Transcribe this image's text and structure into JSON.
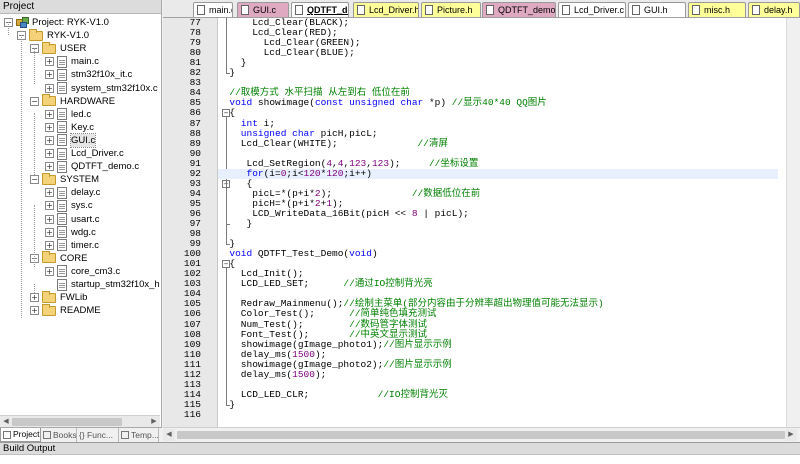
{
  "project_pane": {
    "title": "Project",
    "tree": [
      {
        "label": "Project: RYK-V1.0",
        "kind": "project",
        "level": 0,
        "expander": "-"
      },
      {
        "label": "RYK-V1.0",
        "kind": "folder",
        "level": 1,
        "expander": "-"
      },
      {
        "label": "USER",
        "kind": "folder",
        "level": 2,
        "expander": "-"
      },
      {
        "label": "main.c",
        "kind": "file",
        "level": 3,
        "expander": "+"
      },
      {
        "label": "stm32f10x_it.c",
        "kind": "file",
        "level": 3,
        "expander": "+"
      },
      {
        "label": "system_stm32f10x.c",
        "kind": "file",
        "level": 3,
        "expander": "+"
      },
      {
        "label": "HARDWARE",
        "kind": "folder",
        "level": 2,
        "expander": "-"
      },
      {
        "label": "led.c",
        "kind": "file",
        "level": 3,
        "expander": "+"
      },
      {
        "label": "Key.c",
        "kind": "file",
        "level": 3,
        "expander": "+"
      },
      {
        "label": "GUI.c",
        "kind": "file",
        "level": 3,
        "expander": "+",
        "selected": true
      },
      {
        "label": "Lcd_Driver.c",
        "kind": "file",
        "level": 3,
        "expander": "+"
      },
      {
        "label": "QDTFT_demo.c",
        "kind": "file",
        "level": 3,
        "expander": "+"
      },
      {
        "label": "SYSTEM",
        "kind": "folder",
        "level": 2,
        "expander": "-"
      },
      {
        "label": "delay.c",
        "kind": "file",
        "level": 3,
        "expander": "+"
      },
      {
        "label": "sys.c",
        "kind": "file",
        "level": 3,
        "expander": "+"
      },
      {
        "label": "usart.c",
        "kind": "file",
        "level": 3,
        "expander": "+"
      },
      {
        "label": "wdg.c",
        "kind": "file",
        "level": 3,
        "expander": "+"
      },
      {
        "label": "timer.c",
        "kind": "file",
        "level": 3,
        "expander": "+"
      },
      {
        "label": "CORE",
        "kind": "folder",
        "level": 2,
        "expander": "-"
      },
      {
        "label": "core_cm3.c",
        "kind": "file",
        "level": 3,
        "expander": "+"
      },
      {
        "label": "startup_stm32f10x_hd.s",
        "kind": "file",
        "level": 3,
        "expander": ""
      },
      {
        "label": "FWLib",
        "kind": "folder",
        "level": 2,
        "expander": "+"
      },
      {
        "label": "README",
        "kind": "folder",
        "level": 2,
        "expander": "+"
      }
    ],
    "tabs": [
      {
        "label": "Project",
        "active": true
      },
      {
        "label": "Books",
        "active": false
      },
      {
        "label": "{} Func...",
        "active": false
      },
      {
        "label": "Temp...",
        "active": false
      }
    ]
  },
  "editor_tabs": [
    {
      "label": "main.c",
      "color": "#ffffff",
      "active": false
    },
    {
      "label": "GUI.c",
      "color": "#e0a9c2",
      "active": false
    },
    {
      "label": "QDTFT_demo.c",
      "color": "#ffffff",
      "active": true
    },
    {
      "label": "Lcd_Driver.h",
      "color": "#ffff99",
      "active": false
    },
    {
      "label": "Picture.h",
      "color": "#ffff99",
      "active": false
    },
    {
      "label": "QDTFT_demo.h",
      "color": "#e0a9c2",
      "active": false
    },
    {
      "label": "Lcd_Driver.c",
      "color": "#ffffff",
      "active": false
    },
    {
      "label": "GUI.h",
      "color": "#ffffff",
      "active": false
    },
    {
      "label": "misc.h",
      "color": "#ffff99",
      "active": false
    },
    {
      "label": "delay.h",
      "color": "#ffff99",
      "active": false
    }
  ],
  "editor": {
    "lines": [
      {
        "n": "77",
        "tokens": [
          [
            "",
            "      Lcd_Clear(BLACK);"
          ]
        ]
      },
      {
        "n": "78",
        "tokens": [
          [
            "",
            "      Lcd_Clear(RED);"
          ]
        ]
      },
      {
        "n": "79",
        "tokens": [
          [
            "",
            "        Lcd_Clear(GREEN);"
          ]
        ]
      },
      {
        "n": "80",
        "tokens": [
          [
            "",
            "        Lcd_Clear(BLUE);"
          ]
        ]
      },
      {
        "n": "81",
        "tokens": [
          [
            "",
            "    }"
          ]
        ]
      },
      {
        "n": "82",
        "tokens": [
          [
            "",
            "  }"
          ]
        ]
      },
      {
        "n": "83",
        "tokens": [
          [
            "",
            ""
          ]
        ]
      },
      {
        "n": "84",
        "tokens": [
          [
            "cm",
            "  //取模方式 水平扫描 从左到右 低位在前"
          ]
        ]
      },
      {
        "n": "85",
        "tokens": [
          [
            "kw",
            "  void"
          ],
          [
            "",
            " showimage("
          ],
          [
            "kw",
            "const unsigned char"
          ],
          [
            "",
            " *p) "
          ],
          [
            "cm",
            "//显示40*40 QQ图片"
          ]
        ]
      },
      {
        "n": "86",
        "tokens": [
          [
            "",
            "  {"
          ]
        ]
      },
      {
        "n": "87",
        "tokens": [
          [
            "kw",
            "    int"
          ],
          [
            "",
            " i;"
          ]
        ]
      },
      {
        "n": "88",
        "tokens": [
          [
            "kw",
            "    unsigned char"
          ],
          [
            "",
            " picH,picL;"
          ]
        ]
      },
      {
        "n": "89",
        "tokens": [
          [
            "",
            "    Lcd_Clear(WHITE);              "
          ],
          [
            "cm",
            "//清屏"
          ]
        ]
      },
      {
        "n": "90",
        "tokens": [
          [
            "",
            ""
          ]
        ]
      },
      {
        "n": "91",
        "tokens": [
          [
            "",
            "     Lcd_SetRegion("
          ],
          [
            "num",
            "4"
          ],
          [
            "",
            ","
          ],
          [
            "num",
            "4"
          ],
          [
            "",
            ","
          ],
          [
            "num",
            "123"
          ],
          [
            "",
            ","
          ],
          [
            "num",
            "123"
          ],
          [
            "",
            ");     "
          ],
          [
            "cm",
            "//坐标设置"
          ]
        ]
      },
      {
        "n": "92",
        "tokens": [
          [
            "kw",
            "     for"
          ],
          [
            "",
            "(i="
          ],
          [
            "num",
            "0"
          ],
          [
            "",
            ";i<"
          ],
          [
            "num",
            "120"
          ],
          [
            "",
            "*"
          ],
          [
            "num",
            "120"
          ],
          [
            "",
            ";i++)"
          ]
        ],
        "current": true
      },
      {
        "n": "93",
        "tokens": [
          [
            "",
            "     {"
          ]
        ]
      },
      {
        "n": "94",
        "tokens": [
          [
            "",
            "      picL=*(p+i*"
          ],
          [
            "num",
            "2"
          ],
          [
            "",
            ");              "
          ],
          [
            "cm",
            "//数据低位在前"
          ]
        ]
      },
      {
        "n": "95",
        "tokens": [
          [
            "",
            "      picH=*(p+i*"
          ],
          [
            "num",
            "2"
          ],
          [
            "",
            "+"
          ],
          [
            "num",
            "1"
          ],
          [
            "",
            ");"
          ]
        ]
      },
      {
        "n": "96",
        "tokens": [
          [
            "",
            "      LCD_WriteData_16Bit(picH << "
          ],
          [
            "num",
            "8"
          ],
          [
            "",
            " | picL);"
          ]
        ]
      },
      {
        "n": "97",
        "tokens": [
          [
            "",
            "     }"
          ]
        ]
      },
      {
        "n": "98",
        "tokens": [
          [
            "",
            ""
          ]
        ]
      },
      {
        "n": "99",
        "tokens": [
          [
            "",
            "  }"
          ]
        ]
      },
      {
        "n": "100",
        "tokens": [
          [
            "kw",
            "  void"
          ],
          [
            "",
            " QDTFT_Test_Demo("
          ],
          [
            "kw",
            "void"
          ],
          [
            "",
            ")"
          ]
        ]
      },
      {
        "n": "101",
        "tokens": [
          [
            "",
            "  {"
          ]
        ]
      },
      {
        "n": "102",
        "tokens": [
          [
            "",
            "    Lcd_Init();"
          ]
        ]
      },
      {
        "n": "103",
        "tokens": [
          [
            "",
            "    LCD_LED_SET;      "
          ],
          [
            "cm",
            "//通过IO控制背光亮"
          ]
        ]
      },
      {
        "n": "104",
        "tokens": [
          [
            "",
            ""
          ]
        ]
      },
      {
        "n": "105",
        "tokens": [
          [
            "",
            "    Redraw_Mainmenu();"
          ],
          [
            "cm",
            "//绘制主菜单(部分内容由于分辨率超出物理值可能无法显示)"
          ]
        ]
      },
      {
        "n": "106",
        "tokens": [
          [
            "",
            "    Color_Test();      "
          ],
          [
            "cm",
            "//简单纯色填充测试"
          ]
        ]
      },
      {
        "n": "107",
        "tokens": [
          [
            "",
            "    Num_Test();        "
          ],
          [
            "cm",
            "//数码管字体测试"
          ]
        ]
      },
      {
        "n": "108",
        "tokens": [
          [
            "",
            "    Font_Test();       "
          ],
          [
            "cm",
            "//中英文显示测试"
          ]
        ]
      },
      {
        "n": "109",
        "tokens": [
          [
            "",
            "    showimage(gImage_photo1);"
          ],
          [
            "cm",
            "//图片显示示例"
          ]
        ]
      },
      {
        "n": "110",
        "tokens": [
          [
            "",
            "    delay_ms("
          ],
          [
            "num",
            "1500"
          ],
          [
            "",
            ");"
          ]
        ]
      },
      {
        "n": "111",
        "tokens": [
          [
            "",
            "    showimage(gImage_photo2);"
          ],
          [
            "cm",
            "//图片显示示例"
          ]
        ]
      },
      {
        "n": "112",
        "tokens": [
          [
            "",
            "    delay_ms("
          ],
          [
            "num",
            "1500"
          ],
          [
            "",
            ");"
          ]
        ]
      },
      {
        "n": "113",
        "tokens": [
          [
            "",
            ""
          ]
        ]
      },
      {
        "n": "114",
        "tokens": [
          [
            "",
            "    LCD_LED_CLR;            "
          ],
          [
            "cm",
            "//IO控制背光灭"
          ]
        ]
      },
      {
        "n": "115",
        "tokens": [
          [
            "",
            "  }"
          ]
        ]
      },
      {
        "n": "116",
        "tokens": [
          [
            "",
            ""
          ]
        ]
      }
    ]
  },
  "build_output": {
    "title": "Build Output"
  }
}
